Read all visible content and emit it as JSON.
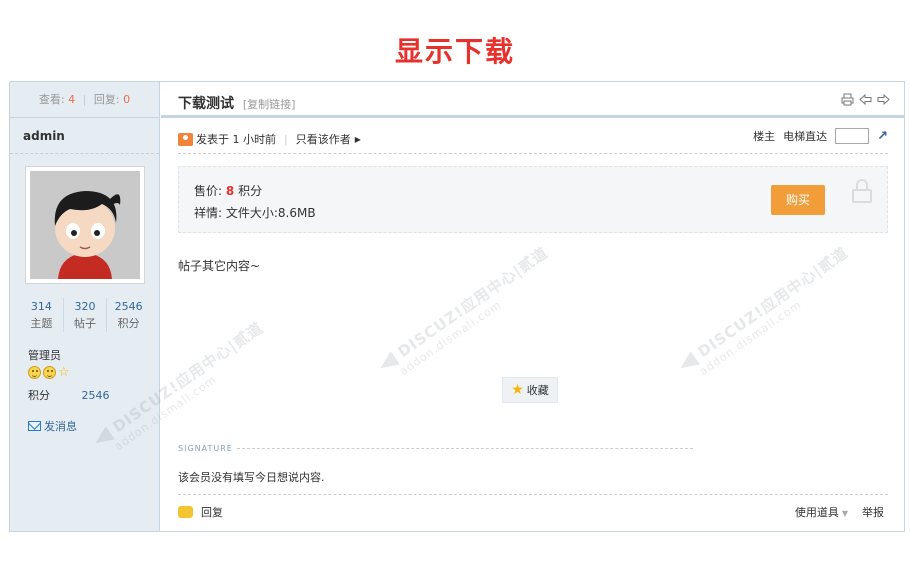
{
  "banner": {
    "title": "显示下载"
  },
  "sidebar": {
    "views_label": "查看:",
    "views": "4",
    "replies_label": "回复:",
    "replies": "0",
    "username": "admin",
    "stats": [
      {
        "value": "314",
        "label": "主题"
      },
      {
        "value": "320",
        "label": "帖子"
      },
      {
        "value": "2546",
        "label": "积分"
      }
    ],
    "group": "管理员",
    "credit_label": "积分",
    "credit_value": "2546",
    "message_label": "发消息"
  },
  "thread": {
    "title": "下载测试",
    "copy_link": "[复制链接]",
    "icons": [
      "print-icon",
      "prev-thread-icon",
      "next-thread-icon"
    ]
  },
  "post": {
    "posted": "发表于 1 小时前",
    "only_author": "只看该作者",
    "floor_owner": "楼主",
    "floor_jump": "电梯直达",
    "pay": {
      "price_label": "售价:",
      "price": "8",
      "price_unit": "积分",
      "detail_label": "祥情:",
      "detail": "文件大小:8.6MB",
      "buy_button": "购买"
    },
    "content": "帖子其它内容~",
    "favorite": "收藏",
    "signature_label": "SIGNATURE",
    "signature": "该会员没有填写今日想说内容.",
    "reply": "回复",
    "use_tool": "使用道具",
    "report": "举报"
  },
  "watermark": {
    "line1": "DISCUZ!应用中心|贰道",
    "line2": "addon.dismall.com"
  },
  "colors": {
    "accent_red": "#e8312c",
    "buy_orange": "#f19e3a",
    "side_bg": "#e5edf2",
    "link_blue": "#336699"
  }
}
